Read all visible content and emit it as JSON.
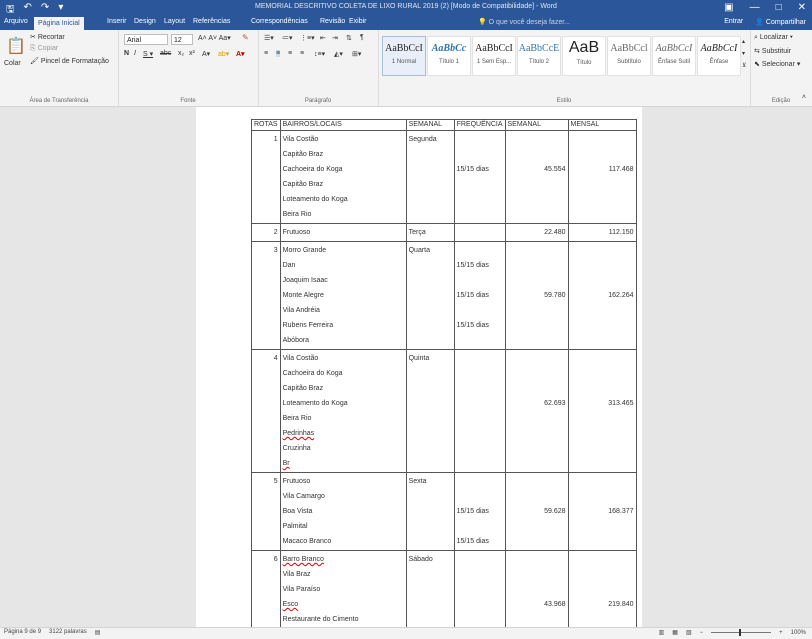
{
  "window": {
    "title": "MEMORIAL DESCRITIVO COLETA DE LIXO RURAL 2019 (2) [Modo de Compatibilidade] - Word",
    "qat": {
      "save_icon": "save-icon",
      "undo": "↶",
      "redo": "↷",
      "customize": "▾"
    },
    "controls": {
      "ribbon_options": "▣",
      "minimize": "—",
      "maximize": "□",
      "close": "✕"
    }
  },
  "tabs": [
    "Arquivo",
    "Página Inicial",
    "Inserir",
    "Design",
    "Layout",
    "Referências",
    "Correspondências",
    "Revisão",
    "Exibir"
  ],
  "tell_me": "O que você deseja fazer...",
  "account": {
    "sign_in": "Entrar",
    "share": "Compartilhar"
  },
  "ribbon": {
    "clipboard": {
      "paste": "Colar",
      "cut": "Recortar",
      "copy": "Copiar",
      "format_painter": "Pincel de Formatação",
      "label": "Área de Transferência"
    },
    "font": {
      "name": "Arial",
      "size": "12",
      "label": "Fonte"
    },
    "paragraph": {
      "label": "Parágrafo"
    },
    "styles": {
      "label": "Estilo",
      "items": [
        {
          "preview": "AaBbCcI",
          "name": "1 Normal"
        },
        {
          "preview": "AaBbCc",
          "name": "Título 1"
        },
        {
          "preview": "AaBbCcI",
          "name": "1 Sem Esp..."
        },
        {
          "preview": "AaBbCcE",
          "name": "Título 2"
        },
        {
          "preview": "AaB",
          "name": "Título"
        },
        {
          "preview": "AaBbCcl",
          "name": "Subtítulo"
        },
        {
          "preview": "AaBbCcI",
          "name": "Ênfase Sutil"
        },
        {
          "preview": "AaBbCcI",
          "name": "Ênfase"
        }
      ]
    },
    "editing": {
      "find": "Localizar",
      "replace": "Substituir",
      "select": "Selecionar",
      "label": "Edição"
    }
  },
  "table": {
    "header": {
      "rotas": "ROTAS",
      "bairros": "BAIRROS/LOCAIS",
      "semanal": "SEMANAL",
      "frequencia": "FREQUÊNCIA",
      "km_semanal": "SEMANAL",
      "km_mensal": "MENSAL"
    },
    "rows": [
      {
        "rota": "1",
        "bairros": [
          "Vila Costão",
          "Capitão Braz",
          "Cachoeira do Koga",
          "Capitão Braz",
          "Loteamento do Koga",
          "Beira Rio"
        ],
        "dia": "Segunda",
        "freq": [
          {
            "text": "15/15 dias",
            "at": 2
          }
        ],
        "km_semanal": "45.554",
        "km_mensal": "117.468",
        "val_at": 2
      },
      {
        "rota": "2",
        "bairros": [
          "Frutuoso"
        ],
        "dia": "Terça",
        "freq": [],
        "km_semanal": "22.480",
        "km_mensal": "112.150",
        "val_at": 0
      },
      {
        "rota": "3",
        "bairros": [
          "Morro Grande",
          "Dan",
          "Joaquim Isaac",
          "Monte Alegre",
          "Vila Andréia",
          "Rubens Ferreira",
          "Abóbora"
        ],
        "dia": "Quarta",
        "freq": [
          {
            "text": "15/15 dias",
            "at": 1
          },
          {
            "text": "15/15 dias",
            "at": 3
          },
          {
            "text": "15/15 dias",
            "at": 5
          }
        ],
        "km_semanal": "59.780",
        "km_mensal": "162.264",
        "val_at": 3
      },
      {
        "rota": "4",
        "bairros": [
          "Vila Costão",
          "Cachoeira do Koga",
          "Capitão Braz",
          "Loteamento do Koga",
          "Beira Rio",
          "Pedrinhas",
          "Cruzinha",
          "Br"
        ],
        "dia": "Quinta",
        "freq": [],
        "km_semanal": "62.693",
        "km_mensal": "313.465",
        "val_at": 3
      },
      {
        "rota": "5",
        "bairros": [
          "Frutuoso",
          "Vila Camargo",
          "Boa Vista",
          "Palmital",
          "Macaco Branco"
        ],
        "dia": "Sexta",
        "freq": [
          {
            "text": "15/15 dias",
            "at": 2
          },
          {
            "text": "15/15 dias",
            "at": 4
          }
        ],
        "km_semanal": "59.628",
        "km_mensal": "168.377",
        "val_at": 2
      },
      {
        "rota": "6",
        "bairros": [
          "Barro Branco",
          "Vila Braz",
          "Vila Paraíso",
          "Esco",
          "Restaurante do Cimento"
        ],
        "dia": "Sábado",
        "freq": [],
        "km_semanal": "43.968",
        "km_mensal": "219.840",
        "val_at": 3
      }
    ]
  },
  "status": {
    "page": "Página 9 de 9",
    "words": "3122 palavras",
    "zoom": "100%"
  }
}
